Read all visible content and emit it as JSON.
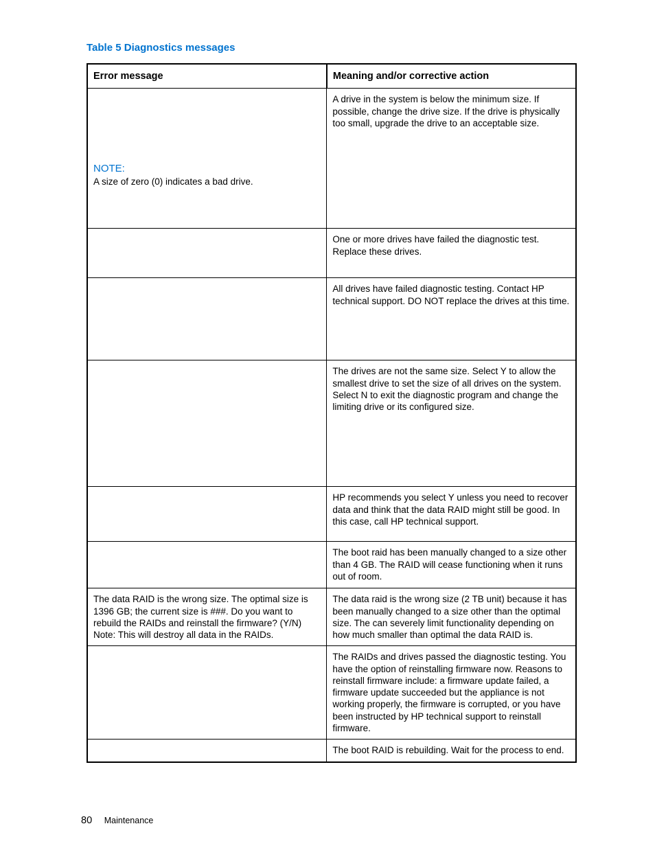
{
  "caption": "Table 5 Diagnostics messages",
  "headers": {
    "col1": "Error message",
    "col2": "Meaning and/or corrective action"
  },
  "noteLabel": "NOTE:",
  "rows": {
    "r1": {
      "leftNote": "A size of zero (0) indicates a bad drive.",
      "right": "A drive in the system is below the minimum size. If possible, change the drive size. If the drive is physically too small, upgrade the drive to an acceptable size."
    },
    "r2": {
      "right": "One or more drives have failed the diagnostic test. Replace these drives."
    },
    "r3": {
      "right": "All drives have failed diagnostic testing. Contact HP technical support. DO NOT replace the drives at this time."
    },
    "r4": {
      "right": "The drives are not the same size. Select Y to allow the smallest drive to set the size of all drives on the system. Select N to exit the diagnostic program and change the limiting drive or its configured size."
    },
    "r5": {
      "right": "HP recommends you select Y unless you need to recover data and think that the data RAID might still be good. In this case, call HP technical support."
    },
    "r6": {
      "right": "The boot raid has been manually changed to a size other than 4 GB. The RAID will cease functioning when it runs out of room."
    },
    "r7": {
      "left": "The data RAID is the wrong size. The optimal size is 1396 GB; the current size is ###. Do you want to rebuild the RAIDs and reinstall the firmware? (Y/N) Note: This will destroy all data in the RAIDs.",
      "right": "The data raid is the wrong size (2 TB unit) because it has been manually changed to a size other than the optimal size. The can severely limit functionality depending on how much smaller than optimal the data RAID is."
    },
    "r8": {
      "right": "The RAIDs and drives passed the diagnostic testing. You have the option of reinstalling firmware now. Reasons to reinstall firmware include: a firmware update failed, a firmware update succeeded but the appliance is not working properly, the firmware is corrupted, or you have been instructed by HP technical support to reinstall firmware."
    },
    "r9": {
      "right": "The boot RAID is rebuilding. Wait for the process to end."
    }
  },
  "footer": {
    "pageNum": "80",
    "section": "Maintenance"
  }
}
